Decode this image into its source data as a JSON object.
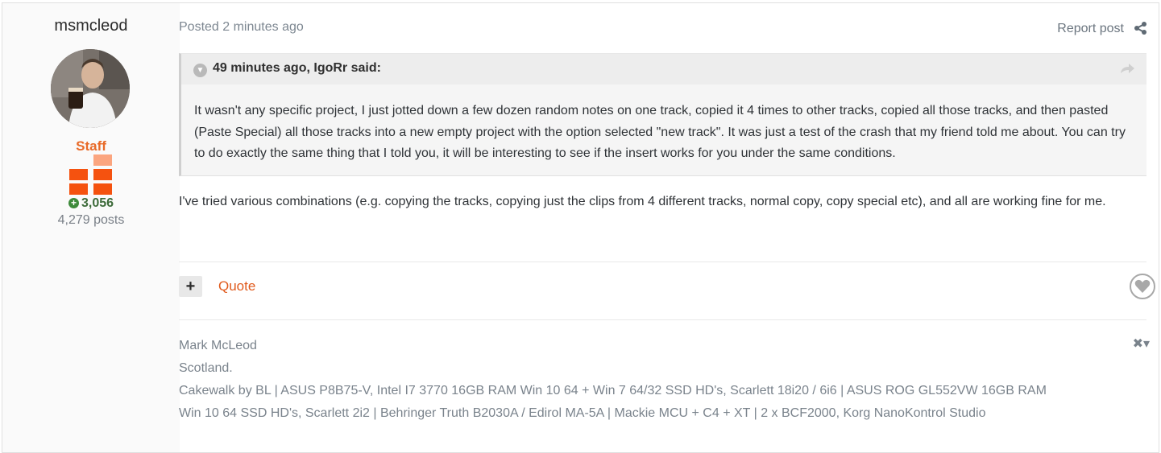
{
  "author": {
    "username": "msmcleod",
    "role": "Staff",
    "reputation": "3,056",
    "posts": "4,279 posts"
  },
  "post": {
    "posted": "Posted 2 minutes ago",
    "report_label": "Report post"
  },
  "quote": {
    "citation": "49 minutes ago, IgoRr said:",
    "text": "It wasn't any specific project, I just jotted down a few dozen random notes on one track, copied it 4 times to other tracks, copied all those tracks, and then pasted (Paste Special) all those tracks into a new empty project with the option selected \"new track\". It was just a test of the crash that my friend told me about. You can try to do exactly the same thing that I told you, it will be interesting to see if the insert works for you under the same conditions."
  },
  "body": {
    "text": "I've tried various combinations (e.g. copying the tracks, copying just the clips from 4 different tracks,  normal copy, copy special etc), and all are working fine for me."
  },
  "actions": {
    "plus": "+",
    "quote_label": "Quote"
  },
  "signature": {
    "line1": "Mark McLeod",
    "line2": "Scotland.",
    "line3": "Cakewalk by BL | ASUS P8B75-V, Intel I7 3770 16GB RAM Win 10 64 + Win 7 64/32 SSD HD's, Scarlett 18i20 / 6i6 | ASUS ROG GL552VW 16GB RAM",
    "line4": "Win 10 64 SSD HD's, Scarlett 2i2 | Behringer Truth B2030A / Edirol MA-5A | Mackie MCU + C4 + XT | 2 x BCF2000, Korg NanoKontrol Studio"
  },
  "colors": {
    "accent": "#e05a1c",
    "staff": "#e86a28",
    "rank": "#f5520f",
    "reputation": "#3d6b3a"
  }
}
